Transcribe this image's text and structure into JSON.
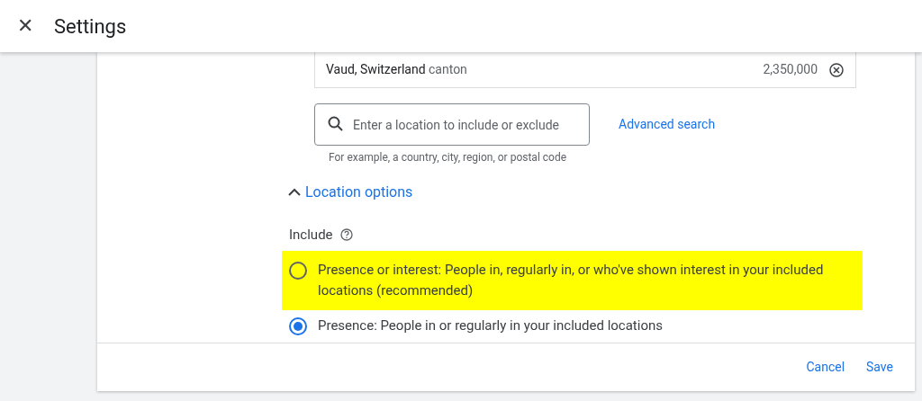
{
  "header": {
    "close_glyph": "✕",
    "title": "Settings"
  },
  "locations": [
    {
      "name": "Vaud, Switzerland",
      "type": "canton",
      "reach": "2,350,000"
    }
  ],
  "search": {
    "placeholder": "Enter a location to include or exclude",
    "helper": "For example, a country, city, region, or postal code"
  },
  "advanced_search": "Advanced search",
  "location_options": {
    "label": "Location options",
    "expanded": true
  },
  "include": {
    "label": "Include",
    "options": [
      {
        "text": "Presence or interest: People in, regularly in, or who've shown interest in your included locations (recommended)",
        "selected": false,
        "highlighted": true
      },
      {
        "text": "Presence: People in or regularly in your included locations",
        "selected": true,
        "highlighted": false
      }
    ]
  },
  "footer": {
    "cancel": "Cancel",
    "save": "Save"
  }
}
